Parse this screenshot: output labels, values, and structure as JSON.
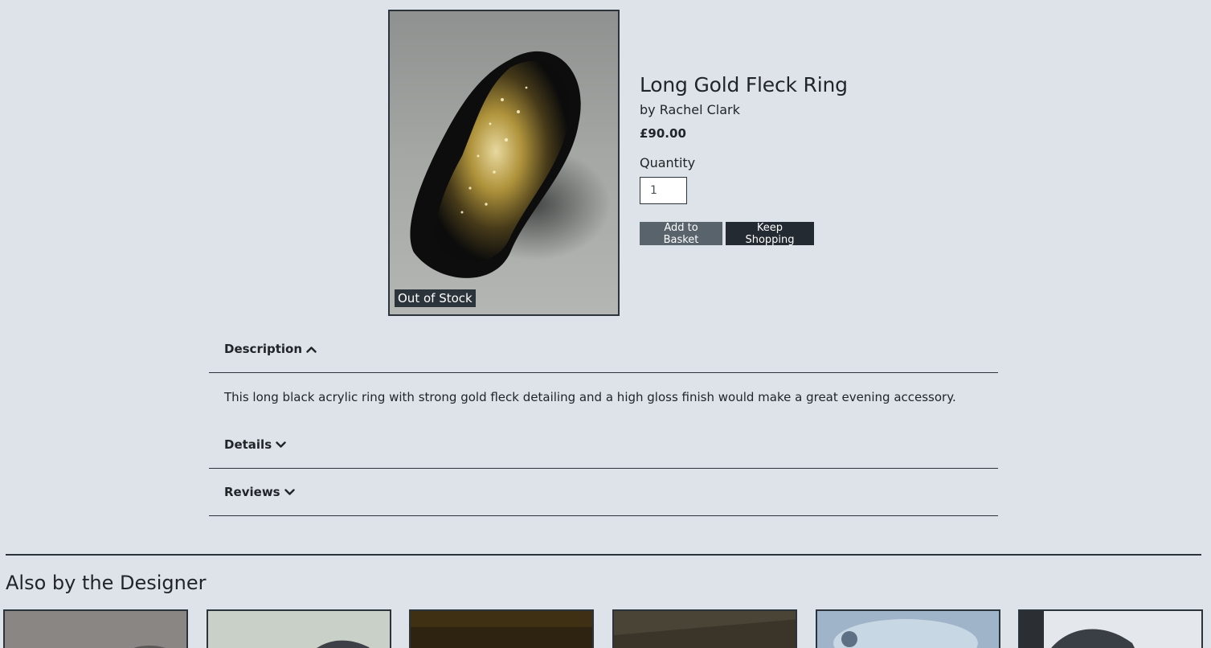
{
  "product": {
    "title": "Long Gold Fleck Ring",
    "designer": "by Rachel Clark",
    "price": "£90.00",
    "stock_badge": "Out of Stock",
    "quantity_label": "Quantity",
    "quantity_value": "1",
    "add_to_basket_label": "Add to Basket",
    "keep_shopping_label": "Keep Shopping"
  },
  "accordion": {
    "description": {
      "label": "Description",
      "icon": "chevron-up-icon",
      "expanded": true,
      "text": "This long black acrylic ring with strong gold fleck detailing and a high gloss finish would make a great evening accessory."
    },
    "details": {
      "label": "Details",
      "icon": "chevron-down-icon",
      "expanded": false
    },
    "reviews": {
      "label": "Reviews",
      "icon": "chevron-down-icon",
      "expanded": false
    }
  },
  "also_by_designer": {
    "title": "Also by the Designer",
    "thumbnails": [
      {
        "tone": "#8a8683"
      },
      {
        "tone": "#c9d0c8"
      },
      {
        "tone": "#3a2a12"
      },
      {
        "tone": "#3b3529"
      },
      {
        "tone": "#9fb4c9"
      },
      {
        "tone": "#d7dde3"
      }
    ]
  },
  "colors": {
    "background": "#dde3e8",
    "dark": "#232a31",
    "button_secondary": "#59636c"
  }
}
